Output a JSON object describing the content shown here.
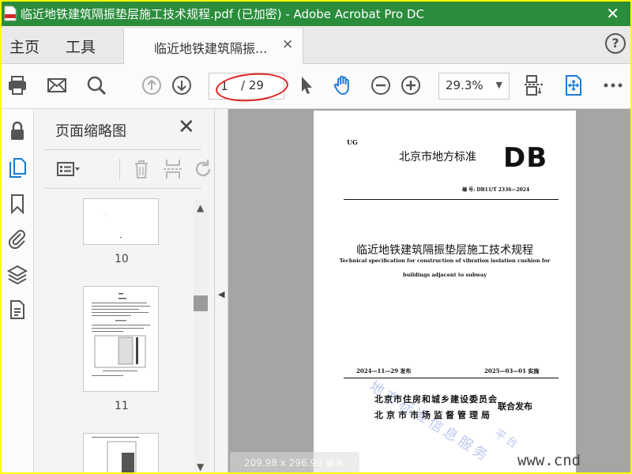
{
  "window": {
    "title": "临近地铁建筑隔振垫层施工技术规程.pdf  (已加密) - Adobe Acrobat Pro DC",
    "close_glyph": "✕"
  },
  "tabs": {
    "home_label": "主页",
    "tools_label": "工具",
    "doc_tab_label": "临近地铁建筑隔振...",
    "doc_tab_close": "×",
    "help_label": "?"
  },
  "toolbar": {
    "page_current": "1",
    "page_total": "/ 29",
    "zoom_value": "29.3%",
    "zoom_caret": "▼",
    "icons": [
      "print-icon",
      "email-icon",
      "search-icon",
      "page-up-icon",
      "page-down-icon",
      "select-arrow-icon",
      "hand-tool-icon",
      "zoom-out-icon",
      "zoom-in-icon",
      "scroll-mode-icon",
      "fit-page-icon",
      "more-icon"
    ]
  },
  "left_rail": {
    "icons": [
      "lock-icon",
      "page-thumbnails-icon",
      "bookmark-icon",
      "attachment-icon",
      "layers-icon",
      "content-icon"
    ]
  },
  "thumbnail_panel": {
    "title": "页面缩略图",
    "close_glyph": "✕",
    "tool_icons": [
      "options-icon",
      "delete-icon",
      "insert-page-icon",
      "rotate-icon"
    ],
    "pages": [
      {
        "label": "10"
      },
      {
        "label": "11"
      }
    ]
  },
  "document_page": {
    "code": "UG",
    "standard_name": "北京市地方标准",
    "db_mark": "DB",
    "number": "编  号: DB11/T 2336—2024",
    "title_cn": "临近地铁建筑隔振垫层施工技术规程",
    "title_en_line1": "Technical specification for construction of vibration isolation cushion for",
    "title_en_line2": "buildings adjacent to subway",
    "issue_date": "2024—11—29 发布",
    "implement_date": "2025—03—01 实施",
    "publisher_1": "北京市住房和城乡建设委员会",
    "publisher_2": "北京市市场监督管理局",
    "joint_release": "联合发布",
    "watermark_1": "地方标准信息服务",
    "watermark_2": "平台"
  },
  "overlay": {
    "size_info": "209.98 x 296.99 毫米",
    "site_watermark": "www.cnd"
  },
  "colors": {
    "titlebar": "#2a8d3c",
    "annotation_red": "#e0201d",
    "icon_blue": "#1a7bd4",
    "border_yellow": "#ffff00"
  }
}
